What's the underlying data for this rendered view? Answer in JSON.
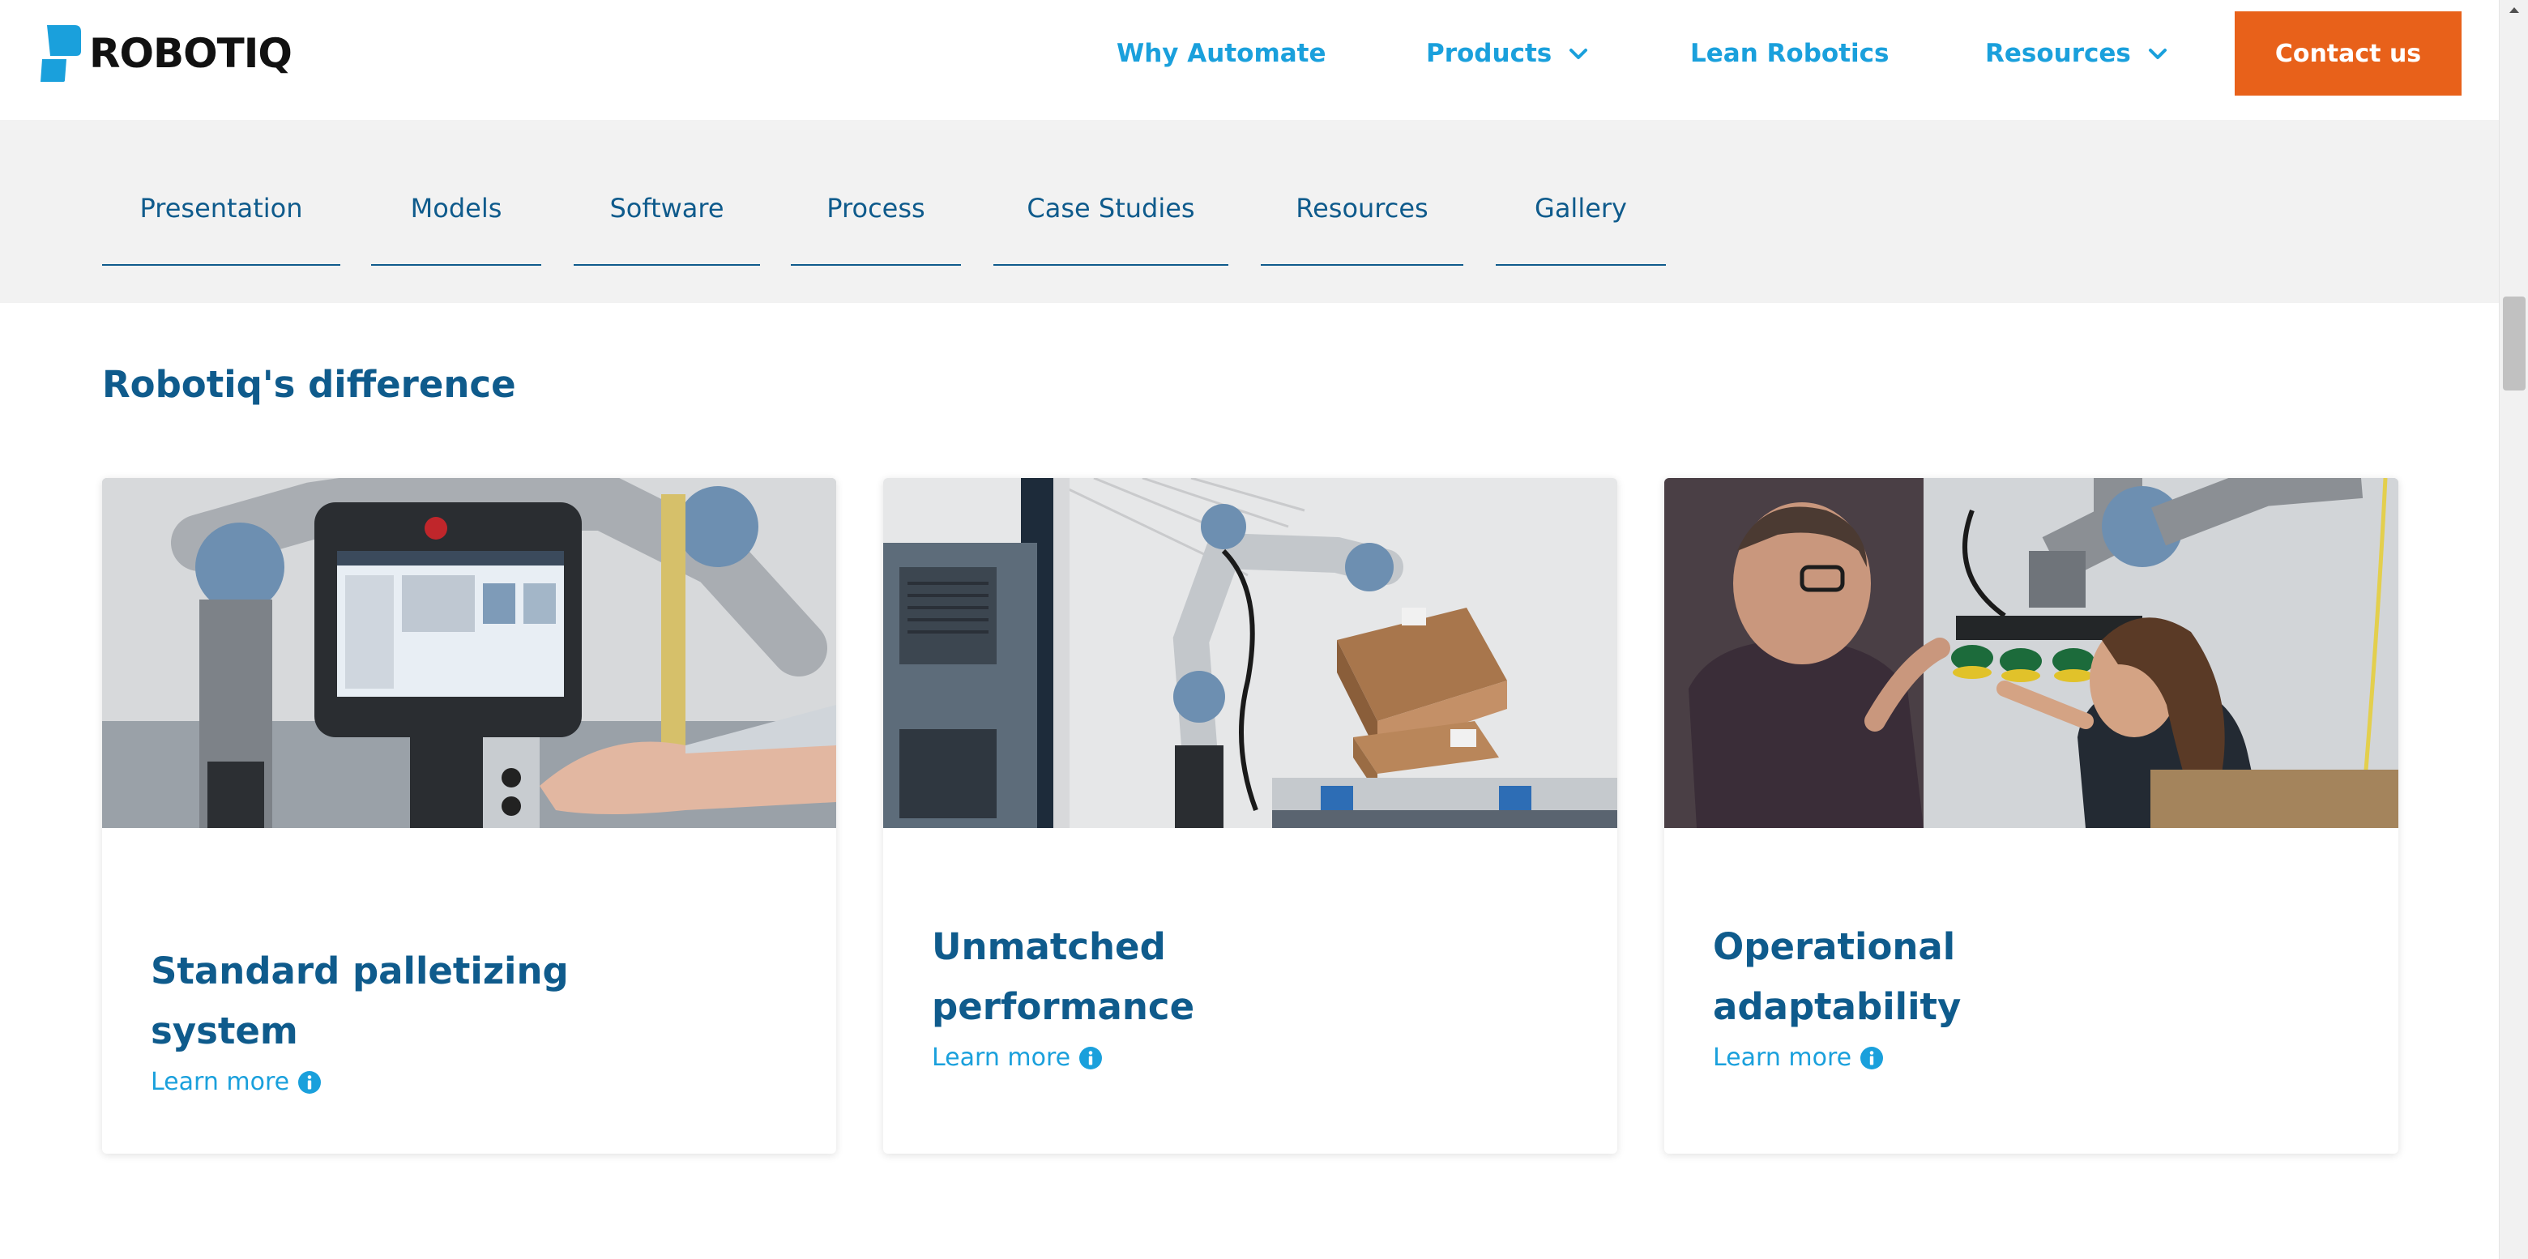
{
  "brand": {
    "logo_text": "ROBOTIQ",
    "accent_blue": "#1aa0dc",
    "dark_blue": "#0f5b8c",
    "orange": "#e8611a"
  },
  "nav": {
    "items": [
      {
        "label": "Why Automate",
        "has_dropdown": false
      },
      {
        "label": "Products",
        "has_dropdown": true
      },
      {
        "label": "Lean Robotics",
        "has_dropdown": false
      },
      {
        "label": "Resources",
        "has_dropdown": true
      }
    ],
    "contact_label": "Contact us"
  },
  "subnav": {
    "tabs": [
      "Presentation",
      "Models",
      "Software",
      "Process",
      "Case Studies",
      "Resources",
      "Gallery"
    ]
  },
  "section": {
    "title": "Robotiq's difference",
    "cards": [
      {
        "title_line1": "Standard palletizing",
        "title_line2": "system",
        "link": "Learn more",
        "image": "teach-pendant-photo"
      },
      {
        "title_line1": "Unmatched",
        "title_line2": "performance",
        "link": "Learn more",
        "image": "palletizer-box-photo"
      },
      {
        "title_line1": "Operational",
        "title_line2": "adaptability",
        "link": "Learn more",
        "image": "vacuum-gripper-photo"
      }
    ]
  }
}
